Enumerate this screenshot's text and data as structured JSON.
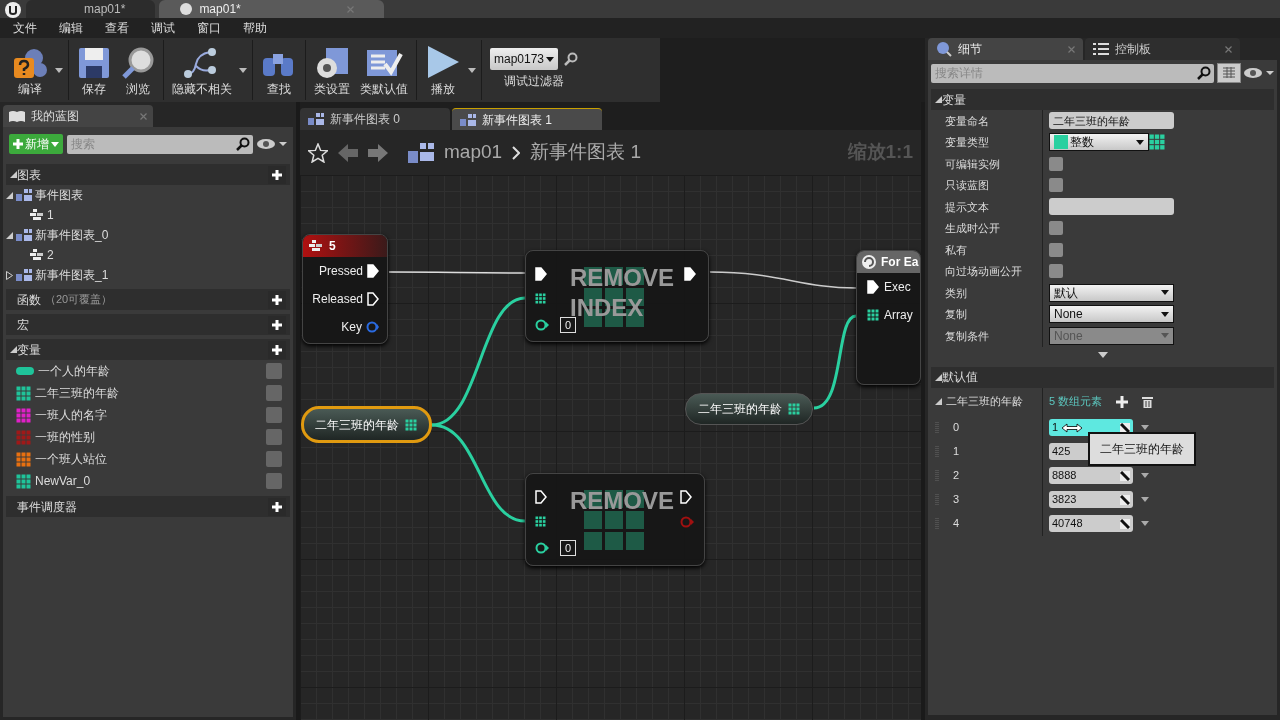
{
  "title_bar": {
    "tabs": [
      {
        "label": "map01*",
        "selected": false
      },
      {
        "label": "map01*",
        "selected": true
      }
    ]
  },
  "menu": [
    "文件",
    "编辑",
    "查看",
    "调试",
    "窗口",
    "帮助"
  ],
  "toolbar": {
    "groups": [
      [
        {
          "kind": "compile",
          "label": "编译",
          "dropdown": true
        }
      ],
      [
        {
          "kind": "save",
          "label": "保存",
          "dropdown": false
        },
        {
          "kind": "browse",
          "label": "浏览",
          "dropdown": false
        }
      ],
      [
        {
          "kind": "hide",
          "label": "隐藏不相关",
          "dropdown": true
        }
      ],
      [
        {
          "kind": "find",
          "label": "查找",
          "dropdown": false
        }
      ],
      [
        {
          "kind": "settings",
          "label": "类设置",
          "dropdown": false
        },
        {
          "kind": "defaults",
          "label": "类默认值",
          "dropdown": false
        }
      ],
      [
        {
          "kind": "play",
          "label": "播放",
          "dropdown": true
        }
      ]
    ],
    "debug_filter": {
      "value": "map0173",
      "label": "调试过滤器"
    }
  },
  "my_blueprint": {
    "tab": "我的蓝图",
    "add_button": "新增",
    "search": {
      "placeholder": "搜索"
    },
    "sections": [
      {
        "title": "图表",
        "expanded": true,
        "items": [
          {
            "label": "事件图表",
            "expanded": true,
            "children": [
              {
                "label": "1"
              }
            ]
          },
          {
            "label": "新事件图表_0",
            "expanded": true,
            "children": [
              {
                "label": "2"
              }
            ]
          },
          {
            "label": "新事件图表_1",
            "expanded": false
          }
        ]
      },
      {
        "title": "函数",
        "note": "（20可覆盖）"
      },
      {
        "title": "宏"
      },
      {
        "title": "变量",
        "expanded": true,
        "variables": [
          {
            "name": "一个人的年龄",
            "kind": "single",
            "color": "#1fc49a"
          },
          {
            "name": "二年三班的年龄",
            "kind": "array",
            "color": "#1fc49a"
          },
          {
            "name": "一班人的名字",
            "kind": "array",
            "color": "#e020c8"
          },
          {
            "name": "一班的性别",
            "kind": "array",
            "color": "#a01818"
          },
          {
            "name": "一个班人站位",
            "kind": "array",
            "color": "#e87010"
          },
          {
            "name": "NewVar_0",
            "kind": "array",
            "color": "#1fc49a"
          }
        ]
      },
      {
        "title": "事件调度器"
      }
    ]
  },
  "graph": {
    "tabs": [
      {
        "label": "新事件图表 0",
        "selected": false
      },
      {
        "label": "新事件图表 1",
        "selected": true
      }
    ],
    "breadcrumb": [
      "map01",
      "新事件图表 1"
    ],
    "zoom": "缩放1:1",
    "nodes": [
      {
        "kind": "event",
        "title": "5",
        "pins": [
          {
            "label": "Pressed",
            "kind": "exec",
            "connected": true
          },
          {
            "label": "Released",
            "kind": "exec",
            "connected": false
          },
          {
            "label": "Key",
            "kind": "key"
          }
        ]
      },
      {
        "kind": "function",
        "title": "REMOVE INDEX",
        "index": "0",
        "exec_in_connected": true,
        "exec_out_connected": true,
        "bool_out": false
      },
      {
        "kind": "function",
        "title": "REMOVE",
        "index": "0",
        "exec_in_connected": false,
        "exec_out_connected": false,
        "bool_out": true
      },
      {
        "kind": "foreach",
        "title": "For Ea",
        "pins": [
          {
            "label": "Exec",
            "kind": "exec",
            "connected": true
          },
          {
            "label": "Array",
            "kind": "array"
          }
        ]
      },
      {
        "kind": "variable",
        "label": "二年三班的年龄",
        "selected": true
      },
      {
        "kind": "variable",
        "label": "二年三班的年龄",
        "selected": false
      }
    ]
  },
  "details": {
    "tabs": [
      {
        "label": "细节",
        "selected": true
      },
      {
        "label": "控制板",
        "selected": false
      }
    ],
    "search": {
      "placeholder": "搜索详情"
    },
    "variable_section": {
      "title": "变量",
      "rows": [
        {
          "label": "变量命名",
          "kind": "text",
          "value": "二年三班的年龄"
        },
        {
          "label": "变量类型",
          "kind": "type",
          "value": "整数"
        },
        {
          "label": "可编辑实例",
          "kind": "checkbox",
          "checked": false
        },
        {
          "label": "只读蓝图",
          "kind": "checkbox",
          "checked": false
        },
        {
          "label": "提示文本",
          "kind": "text"
        },
        {
          "label": "生成时公开",
          "kind": "checkbox",
          "checked": false
        },
        {
          "label": "私有",
          "kind": "checkbox",
          "checked": false
        },
        {
          "label": "向过场动画公开",
          "kind": "checkbox",
          "checked": false
        },
        {
          "label": "类别",
          "kind": "dropdown",
          "value": "默认",
          "disabled": false
        },
        {
          "label": "复制",
          "kind": "dropdown",
          "value": "None",
          "disabled": false
        },
        {
          "label": "复制条件",
          "kind": "dropdown",
          "value": "None",
          "disabled": true
        }
      ]
    },
    "defaults_section": {
      "title": "默认值",
      "array_name": "二年三班的年龄",
      "count": "5 数组元素",
      "elements": [
        {
          "index": "0",
          "value": "1",
          "hovered": true
        },
        {
          "index": "1",
          "value": "425",
          "hovered": false
        },
        {
          "index": "2",
          "value": "8888",
          "hovered": false
        },
        {
          "index": "3",
          "value": "3823",
          "hovered": false
        },
        {
          "index": "4",
          "value": "40748",
          "hovered": false
        }
      ],
      "tooltip": "二年三班的年龄"
    }
  }
}
